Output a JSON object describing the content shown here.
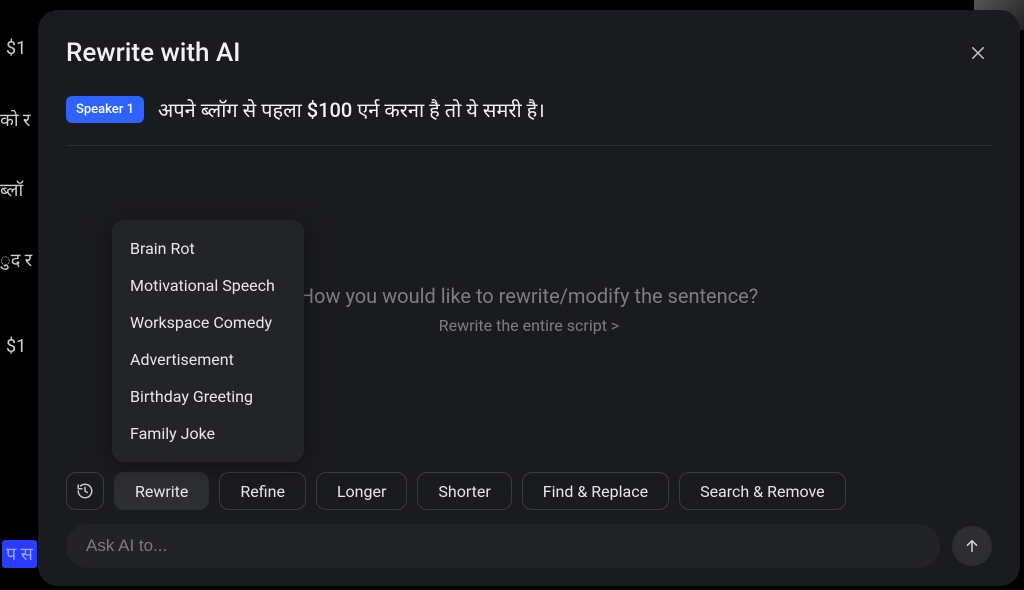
{
  "background": {
    "text1": "$1",
    "text2": "को र",
    "text3": "ब्लॉ",
    "text4": "ुद र",
    "text5": "$1",
    "text6": "प स"
  },
  "modal": {
    "title": "Rewrite with AI",
    "speaker_badge": "Speaker 1",
    "sentence": "अपने ब्लॉग से पहला $100 एर्न करना है तो ये समरी है।",
    "prompt_main": "How you would like to rewrite/modify the sentence?",
    "prompt_sub": "Rewrite the entire script >",
    "input_placeholder": "Ask AI to..."
  },
  "dropdown": {
    "items": [
      "Brain Rot",
      "Motivational Speech",
      "Workspace Comedy",
      "Advertisement",
      "Birthday Greeting",
      "Family Joke"
    ]
  },
  "actions": {
    "rewrite": "Rewrite",
    "refine": "Refine",
    "longer": "Longer",
    "shorter": "Shorter",
    "find_replace": "Find & Replace",
    "search_remove": "Search & Remove"
  }
}
